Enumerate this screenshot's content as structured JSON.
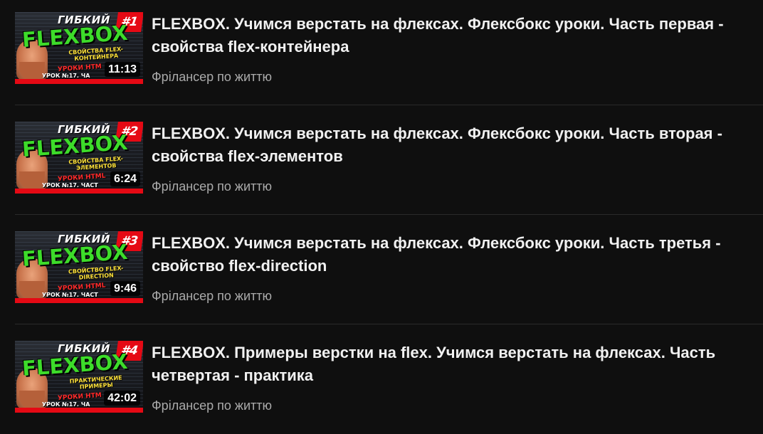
{
  "videos": [
    {
      "title": "FLEXBOX. Учимся верстать на флексах. Флексбокс уроки. Часть первая - свойства flex-контейнера",
      "channel": "Фрілансер по життю",
      "duration": "11:13",
      "thumb": {
        "top_text": "ГИБКИЙ",
        "number": "#1",
        "big_text": "FLEXBOX",
        "sub_text": "СВОЙСТВА FLEX-КОНТЕЙНЕРА",
        "lesson_text": "УРОКИ HTM",
        "lesson_no": "УРОК №17. ЧА"
      }
    },
    {
      "title": "FLEXBOX. Учимся верстать на флексах. Флексбокс уроки. Часть вторая - свойства flex-элементов",
      "channel": "Фрілансер по життю",
      "duration": "6:24",
      "thumb": {
        "top_text": "ГИБКИЙ",
        "number": "#2",
        "big_text": "FLEXBOX",
        "sub_text": "СВОЙСТВА FLEX-ЭЛЕМЕНТОВ",
        "lesson_text": "УРОКИ HTML",
        "lesson_no": "УРОК №17. ЧАСТ"
      }
    },
    {
      "title": "FLEXBOX. Учимся верстать на флексах. Флексбокс уроки. Часть третья - свойство flex-direction",
      "channel": "Фрілансер по життю",
      "duration": "9:46",
      "thumb": {
        "top_text": "ГИБКИЙ",
        "number": "#3",
        "big_text": "FLEXBOX",
        "sub_text": "СВОЙСТВО FLEX-DIRECTION",
        "lesson_text": "УРОКИ HTML",
        "lesson_no": "УРОК №17. ЧАСТ"
      }
    },
    {
      "title": "FLEXBOX. Примеры верстки на flex. Учимся верстать на флексах. Часть четвертая - практика",
      "channel": "Фрілансер по життю",
      "duration": "42:02",
      "thumb": {
        "top_text": "ГИБКИЙ",
        "number": "#4",
        "big_text": "FLEXBOX",
        "sub_text": "ПРАКТИЧЕСКИЕ ПРИМЕРЫ",
        "lesson_text": "УРОКИ HTM",
        "lesson_no": "УРОК №17. ЧА"
      }
    }
  ],
  "colors": {
    "background": "#0f0f0f",
    "title": "#f1f1f1",
    "channel": "#aaaaaa",
    "divider": "#2a2a2a",
    "brand_red": "#e50914",
    "flexbox_green": "#3ddc2a"
  }
}
